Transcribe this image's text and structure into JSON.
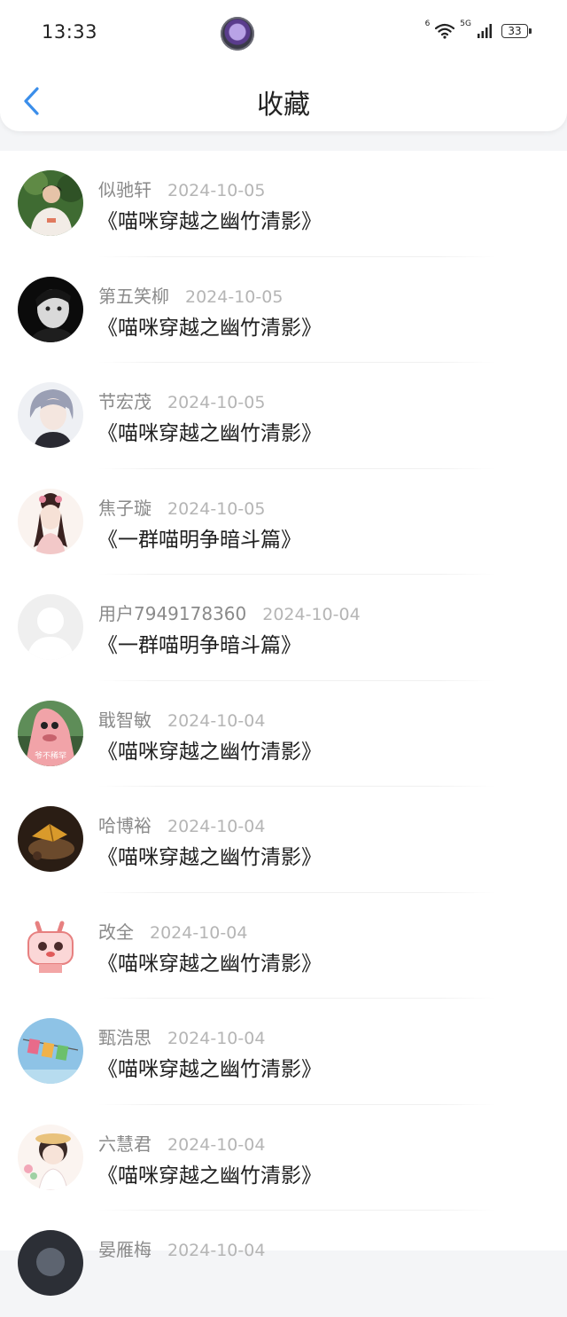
{
  "status_bar": {
    "time": "13:33",
    "network_tag": "6",
    "network_gen": "5G",
    "battery": "33"
  },
  "header": {
    "title": "收藏",
    "back_icon": "chevron-left-icon"
  },
  "colors": {
    "accent": "#3b8eea",
    "background": "#f4f5f7"
  },
  "items": [
    {
      "user": "似驰轩",
      "date": "2024-10-05",
      "title": "《喵咪穿越之幽竹清影》"
    },
    {
      "user": "第五笑柳",
      "date": "2024-10-05",
      "title": "《喵咪穿越之幽竹清影》"
    },
    {
      "user": "节宏茂",
      "date": "2024-10-05",
      "title": "《喵咪穿越之幽竹清影》"
    },
    {
      "user": "焦子璇",
      "date": "2024-10-05",
      "title": "《一群喵明争暗斗篇》"
    },
    {
      "user": "用户7949178360",
      "date": "2024-10-04",
      "title": "《一群喵明争暗斗篇》"
    },
    {
      "user": "戢智敏",
      "date": "2024-10-04",
      "title": "《喵咪穿越之幽竹清影》",
      "avatar_caption": "爷不稀罕"
    },
    {
      "user": "哈博裕",
      "date": "2024-10-04",
      "title": "《喵咪穿越之幽竹清影》"
    },
    {
      "user": "改全",
      "date": "2024-10-04",
      "title": "《喵咪穿越之幽竹清影》"
    },
    {
      "user": "甄浩思",
      "date": "2024-10-04",
      "title": "《喵咪穿越之幽竹清影》"
    },
    {
      "user": "六慧君",
      "date": "2024-10-04",
      "title": "《喵咪穿越之幽竹清影》"
    },
    {
      "user": "晏雁梅",
      "date": "2024-10-04",
      "title": ""
    }
  ]
}
